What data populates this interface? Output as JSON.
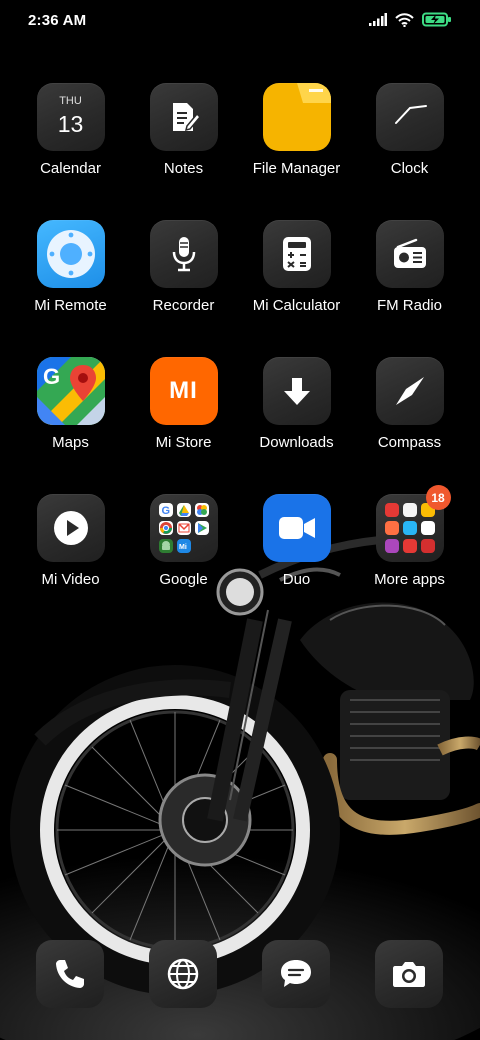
{
  "status_bar": {
    "time": "2:36 AM",
    "icons": [
      "signal-icon",
      "wifi-icon",
      "battery-charging-icon"
    ]
  },
  "apps": [
    {
      "label": "Calendar",
      "icon": "calendar-icon",
      "day": "THU",
      "date": "13"
    },
    {
      "label": "Notes",
      "icon": "notes-icon"
    },
    {
      "label": "File Manager",
      "icon": "folder-icon"
    },
    {
      "label": "Clock",
      "icon": "clock-icon"
    },
    {
      "label": "Mi Remote",
      "icon": "remote-icon"
    },
    {
      "label": "Recorder",
      "icon": "microphone-icon"
    },
    {
      "label": "Mi Calculator",
      "icon": "calculator-icon"
    },
    {
      "label": "FM Radio",
      "icon": "radio-icon"
    },
    {
      "label": "Maps",
      "icon": "maps-icon"
    },
    {
      "label": "Mi Store",
      "icon": "mi-store-icon",
      "logo_text": "MI"
    },
    {
      "label": "Downloads",
      "icon": "download-icon"
    },
    {
      "label": "Compass",
      "icon": "compass-icon"
    },
    {
      "label": "Mi Video",
      "icon": "play-icon"
    },
    {
      "label": "Google",
      "icon": "folder-google-icon"
    },
    {
      "label": "Duo",
      "icon": "video-camera-icon"
    },
    {
      "label": "More apps",
      "icon": "folder-more-apps-icon",
      "badge": "18"
    }
  ],
  "dock": [
    {
      "icon": "phone-icon"
    },
    {
      "icon": "browser-globe-icon"
    },
    {
      "icon": "messages-icon"
    },
    {
      "icon": "camera-icon"
    }
  ],
  "colors": {
    "file_manager": "#f6b400",
    "mi_remote": "#2aa3f5",
    "mi_store": "#ff6700",
    "duo": "#1a73e8",
    "badge": "#f0582e"
  }
}
